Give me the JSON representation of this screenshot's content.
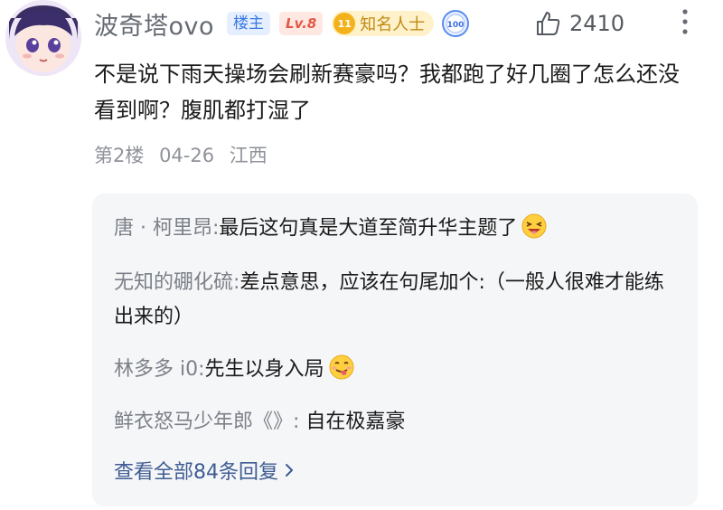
{
  "comment": {
    "username": "波奇塔ovo",
    "badges": {
      "owner": "楼主",
      "level": "Lv.8",
      "famous_number": "11",
      "famous_label": "知名人士",
      "medal_text": "100"
    },
    "like_count": "2410",
    "text": "不是说下雨天操场会刷新赛豪吗？我都跑了好几圈了怎么还没看到啊？腹肌都打湿了",
    "floor": "第2楼",
    "date": "04-26",
    "location": "江西"
  },
  "replies": [
    {
      "name": "唐 · 柯里昂",
      "separator": ":",
      "text": "最后这句真是大道至简升华主题了",
      "emoji": "laughing-face-emoji"
    },
    {
      "name": "无知的硼化硫",
      "separator": ":",
      "text": "差点意思，应该在句尾加个:（一般人很难才能练出来的）",
      "emoji": ""
    },
    {
      "name": "林多多 i0",
      "separator": ":",
      "text": "先生以身入局",
      "emoji": "tongue-face-emoji"
    },
    {
      "name": "鲜衣怒马少年郎《》",
      "separator": ":",
      "text": " 自在极嘉豪",
      "emoji": ""
    }
  ],
  "view_all": "查看全部84条回复",
  "colors": {
    "link": "#3f5c93",
    "owner_badge": "#3a78e6",
    "level_badge": "#e25a46",
    "famous_badge": "#c08a13"
  }
}
